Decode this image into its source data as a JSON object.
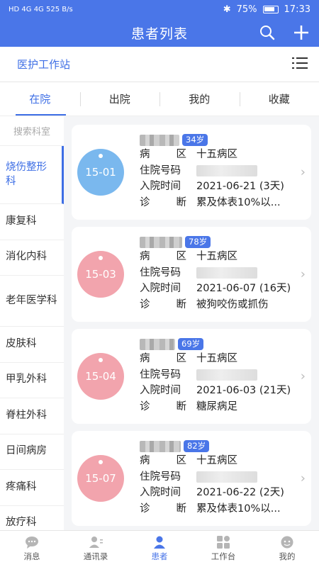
{
  "status": {
    "left": "HD 4G 4G 525 B/s",
    "battery": "75%",
    "time": "17:33"
  },
  "header": {
    "title": "患者列表"
  },
  "workstation": {
    "label": "医护工作站"
  },
  "tabs": [
    {
      "label": "在院"
    },
    {
      "label": "出院"
    },
    {
      "label": "我的"
    },
    {
      "label": "收藏"
    }
  ],
  "sidebar": {
    "search_label": "搜索科室",
    "items": [
      {
        "label": "烧伤整形科"
      },
      {
        "label": "康复科"
      },
      {
        "label": "消化内科"
      },
      {
        "label": "老年医学科"
      },
      {
        "label": "皮肤科"
      },
      {
        "label": "甲乳外科"
      },
      {
        "label": "脊柱外科"
      },
      {
        "label": "日间病房"
      },
      {
        "label": "疼痛科"
      },
      {
        "label": "放疗科"
      }
    ]
  },
  "field_labels": {
    "ward": "病区",
    "id": "住院号码",
    "admit": "入院时间",
    "diag": "诊断"
  },
  "patients": [
    {
      "bed": "15-01",
      "age": "34岁",
      "ward": "十五病区",
      "admit": "2021-06-21 (3天)",
      "diag": "累及体表10%以...",
      "color": "#7ab8ee"
    },
    {
      "bed": "15-03",
      "age": "78岁",
      "ward": "十五病区",
      "admit": "2021-06-07 (16天)",
      "diag": "被狗咬伤或抓伤",
      "color": "#f2a4ad"
    },
    {
      "bed": "15-04",
      "age": "69岁",
      "ward": "十五病区",
      "admit": "2021-06-03 (21天)",
      "diag": "糖尿病足",
      "color": "#f2a4ad"
    },
    {
      "bed": "15-07",
      "age": "82岁",
      "ward": "十五病区",
      "admit": "2021-06-22 (2天)",
      "diag": "累及体表10%以...",
      "color": "#f2a4ad"
    }
  ],
  "bottomnav": [
    {
      "label": "消息",
      "icon": "chat-icon"
    },
    {
      "label": "通讯录",
      "icon": "contacts-icon"
    },
    {
      "label": "患者",
      "icon": "patient-icon"
    },
    {
      "label": "工作台",
      "icon": "workbench-icon"
    },
    {
      "label": "我的",
      "icon": "profile-icon"
    }
  ]
}
